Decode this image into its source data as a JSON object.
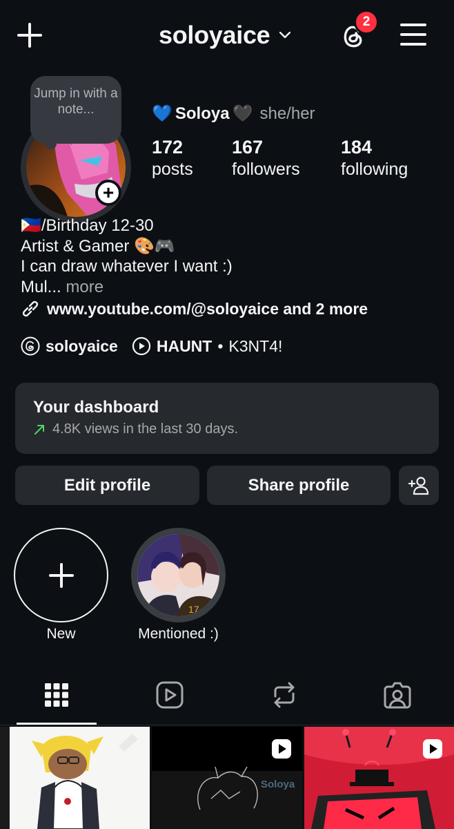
{
  "header": {
    "username": "soloyaice",
    "notification_count": "2"
  },
  "note": {
    "text": "Jump in with a note..."
  },
  "profile": {
    "heart_blue": "💙",
    "name": "Soloya",
    "heart_black": "🖤",
    "pronouns": "she/her",
    "stats": [
      {
        "value": "172",
        "label": "posts"
      },
      {
        "value": "167",
        "label": "followers"
      },
      {
        "value": "184",
        "label": "following"
      }
    ]
  },
  "bio": {
    "line1": "🇵🇭/Birthday 12-30",
    "line2": "Artist & Gamer 🎨🎮",
    "line3": "I can draw whatever I want :)",
    "line4": "Mul...",
    "more": "more",
    "link": "www.youtube.com/@soloyaice and 2 more",
    "threads_handle": "soloyaice",
    "music_title": "HAUNT",
    "music_separator": "•",
    "music_artist": "K3NT4!"
  },
  "dashboard": {
    "title": "Your dashboard",
    "subtitle": "4.8K views in the last 30 days."
  },
  "buttons": {
    "edit": "Edit profile",
    "share": "Share profile"
  },
  "highlights": [
    {
      "label": "New"
    },
    {
      "label": "Mentioned :)"
    }
  ],
  "tabs": [
    "grid-icon",
    "reels-icon",
    "reposts-icon",
    "tagged-icon"
  ],
  "colors": {
    "background": "#0c1014",
    "surface": "#26292e",
    "badge": "#ff3040",
    "trend": "#4cd964"
  }
}
